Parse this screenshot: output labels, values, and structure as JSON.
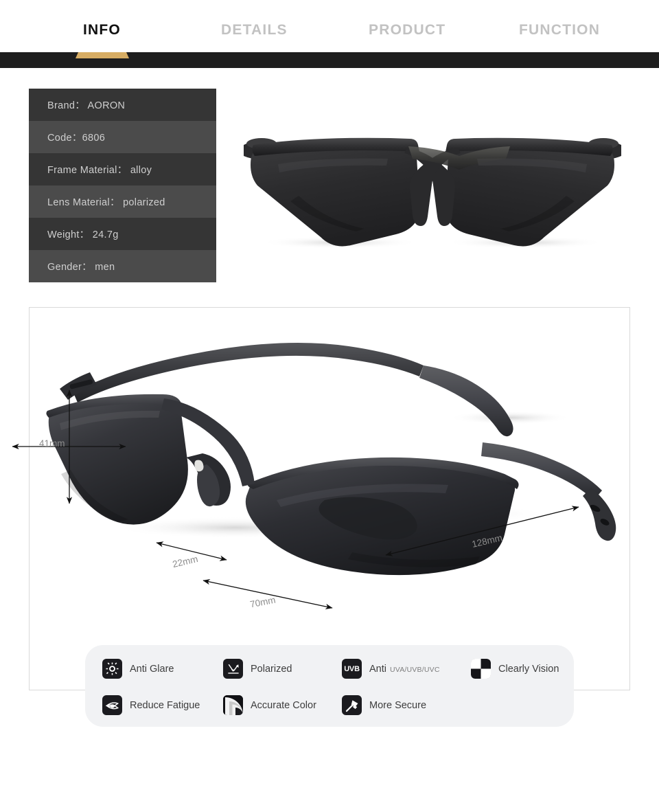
{
  "nav": {
    "tabs": [
      {
        "label": "INFO",
        "active": true
      },
      {
        "label": "DETAILS",
        "active": false
      },
      {
        "label": "PRODUCT",
        "active": false
      },
      {
        "label": "FUNCTION",
        "active": false
      }
    ],
    "indicator_color": "#d7ad64",
    "bar_color": "#1e1e1e"
  },
  "specs": {
    "rows": [
      {
        "label": "Brand",
        "value": "AORON"
      },
      {
        "label": "Code",
        "value": "6806"
      },
      {
        "label": "Frame Material",
        "value": "alloy"
      },
      {
        "label": "Lens Material",
        "value": "polarized"
      },
      {
        "label": "Weight",
        "value": "24.7g"
      },
      {
        "label": "Gender",
        "value": "men"
      }
    ],
    "text": [
      "Brand： AORON",
      "Code：6806",
      "Frame Material： alloy",
      "Lens Material： polarized",
      "Weight： 24.7g",
      "Gender： men"
    ]
  },
  "dimensions": {
    "height": "41mm",
    "bridge": "22mm",
    "front_width": "70mm",
    "temple_length": "128mm"
  },
  "features": [
    {
      "name": "anti-glare",
      "label": "Anti Glare",
      "sub": "",
      "icon": "sun-gear-icon"
    },
    {
      "name": "reduce-fatigue",
      "label": "Reduce Fatigue",
      "sub": "",
      "icon": "eye-icon"
    },
    {
      "name": "polarized",
      "label": "Polarized",
      "sub": "",
      "icon": "reflect-arrows-icon"
    },
    {
      "name": "accurate-color",
      "label": "Accurate Color",
      "sub": "",
      "icon": "color-ring-icon"
    },
    {
      "name": "anti-uv",
      "label": "Anti",
      "sub": "UVA/UVB/UVC",
      "icon": "uvb-badge-icon"
    },
    {
      "name": "more-secure",
      "label": "More Secure",
      "sub": "",
      "icon": "hammer-icon"
    },
    {
      "name": "clearly-vision",
      "label": "Clearly Vision",
      "sub": "",
      "icon": "checkerboard-icon"
    }
  ],
  "icon_text": {
    "uvb": "UVB"
  },
  "colors": {
    "accent_gold": "#d7ad64",
    "dark_bar": "#1e1e1e",
    "spec_row_dark": "#353535",
    "spec_row_light": "#4b4b4b",
    "feature_card_bg": "#f1f2f4",
    "panel_border": "#d9d9d9"
  }
}
